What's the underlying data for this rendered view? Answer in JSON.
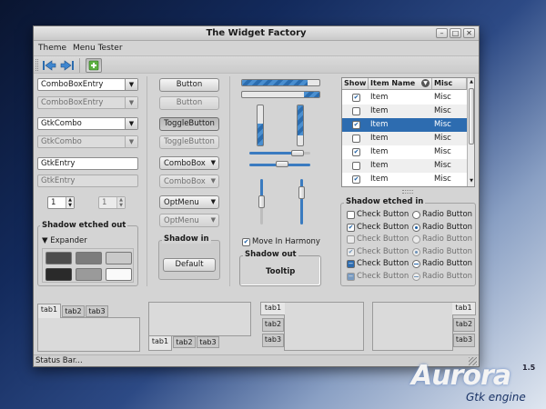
{
  "window": {
    "title": "The Widget Factory",
    "buttons": [
      "–",
      "□",
      "✕"
    ]
  },
  "menubar": {
    "items": [
      "Theme",
      "Menu Tester"
    ]
  },
  "toolbar": {
    "icons": [
      "back-arrow-icon",
      "forward-arrow-icon",
      "add-icon"
    ]
  },
  "col1": {
    "combo_entry": "ComboBoxEntry",
    "combo_entry_disabled": "ComboBoxEntry",
    "gtk_combo": "GtkCombo",
    "gtk_combo_disabled": "GtkCombo",
    "gtk_entry": "GtkEntry",
    "gtk_entry_disabled": "GtkEntry",
    "spin_value": "1",
    "spin_value_disabled": "1",
    "frame_label": "Shadow etched out",
    "expander_label": "Expander",
    "expander_arrow": "▼"
  },
  "col2": {
    "button": "Button",
    "button_disabled": "Button",
    "toggle": "ToggleButton",
    "toggle_disabled": "ToggleButton",
    "combobox": "ComboBox",
    "combobox_disabled": "ComboBox",
    "optmenu": "OptMenu",
    "optmenu_disabled": "OptMenu",
    "frame_label": "Shadow in",
    "default_button": "Default"
  },
  "col3": {
    "move_in_harmony": "Move In Harmony",
    "frame_label": "Shadow out",
    "tooltip_button": "Tooltip",
    "progress": {
      "h1": 0.85,
      "h2": 0.2,
      "v1": 0.55,
      "v2": 0.75
    }
  },
  "tree": {
    "columns": [
      "Show",
      "Item Name",
      "Misc"
    ],
    "rows": [
      {
        "show": true,
        "item": "Item",
        "misc": "Misc",
        "selected": false
      },
      {
        "show": false,
        "item": "Item",
        "misc": "Misc",
        "selected": false
      },
      {
        "show": true,
        "item": "Item",
        "misc": "Misc",
        "selected": true
      },
      {
        "show": false,
        "item": "Item",
        "misc": "Misc",
        "selected": false
      },
      {
        "show": true,
        "item": "Item",
        "misc": "Misc",
        "selected": false
      },
      {
        "show": false,
        "item": "Item",
        "misc": "Misc",
        "selected": false
      },
      {
        "show": true,
        "item": "Item",
        "misc": "Misc",
        "selected": false
      }
    ]
  },
  "checks_frame": {
    "label": "Shadow etched in",
    "check_label": "Check Button",
    "radio_label": "Radio Button"
  },
  "notebooks": {
    "tabs": [
      "tab1",
      "tab2",
      "tab3"
    ]
  },
  "statusbar": {
    "text": "Status Bar..."
  },
  "logo": {
    "main": "Aurora",
    "sub": "Gtk engine",
    "version": "1.5"
  },
  "colors": {
    "accent": "#2d6cb0",
    "window_bg": "#d4d4d4"
  }
}
